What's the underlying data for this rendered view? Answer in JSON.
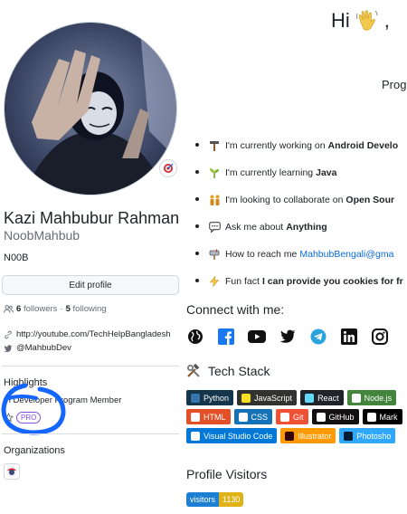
{
  "profile": {
    "full_name": "Kazi Mahbubur Rahman",
    "username": "NoobMahbub",
    "bio": "N00B",
    "edit_profile_label": "Edit profile",
    "followers_count": "6",
    "followers_label": "followers",
    "separator": "·",
    "following_count": "5",
    "following_label": "following",
    "website": "http://youtube.com/TechHelpBangladesh",
    "twitter": "@MahbubDev",
    "status_icon": "target-icon"
  },
  "highlights": {
    "title": "Highlights",
    "program_text": "th Developer Program Member",
    "pro_label": "PRO"
  },
  "organizations": {
    "title": "Organizations"
  },
  "readme": {
    "greeting": "Hi",
    "greeting_tail": ",",
    "section_title": "Prog",
    "about": [
      {
        "icon": "hammer-icon",
        "text": "I'm currently working on",
        "bold": "Android Develo"
      },
      {
        "icon": "sprout-icon",
        "text": "I'm currently learning",
        "bold": "Java"
      },
      {
        "icon": "people-icon",
        "text": "I'm looking to collaborate on",
        "bold": "Open Sour"
      },
      {
        "icon": "speech-bubble-icon",
        "text": "Ask me about",
        "bold": "Anything"
      },
      {
        "icon": "mailbox-icon",
        "text": "How to reach me",
        "link": "MahbubBengali@gma"
      },
      {
        "icon": "lightning-icon",
        "text": "Fun fact",
        "bold": "I can provide you cookies for fr"
      }
    ],
    "connect_title": "Connect with me:",
    "socials": [
      "globe-icon",
      "facebook-icon",
      "youtube-icon",
      "twitter-icon",
      "telegram-icon",
      "linkedin-icon",
      "instagram-icon"
    ],
    "tech_title": "Tech Stack",
    "tech_rows": [
      [
        {
          "label": "Python",
          "bg": "#14354c",
          "icon": "#3776ab"
        },
        {
          "label": "JavaScript",
          "bg": "#323330",
          "icon": "#f7df1e"
        },
        {
          "label": "React",
          "bg": "#20232a",
          "icon": "#61dafb"
        },
        {
          "label": "Node.js",
          "bg": "#43853d",
          "icon": "#ffffff"
        }
      ],
      [
        {
          "label": "HTML",
          "bg": "#e34f26",
          "icon": "#ffffff"
        },
        {
          "label": "CSS",
          "bg": "#1572b6",
          "icon": "#ffffff"
        },
        {
          "label": "Git",
          "bg": "#f05033",
          "icon": "#ffffff"
        },
        {
          "label": "GitHub",
          "bg": "#121011",
          "icon": "#ffffff"
        },
        {
          "label": "Mark",
          "bg": "#000000",
          "icon": "#ffffff"
        }
      ],
      [
        {
          "label": "Visual Studio Code",
          "bg": "#0078d7",
          "icon": "#ffffff"
        },
        {
          "label": "Illustrator",
          "bg": "#ff9a00",
          "icon": "#330000"
        },
        {
          "label": "Photosho",
          "bg": "#31a8ff",
          "icon": "#001e36"
        }
      ]
    ],
    "visitors_title": "Profile Visitors",
    "visitors_label": "visitors",
    "visitors_count": "1130"
  }
}
